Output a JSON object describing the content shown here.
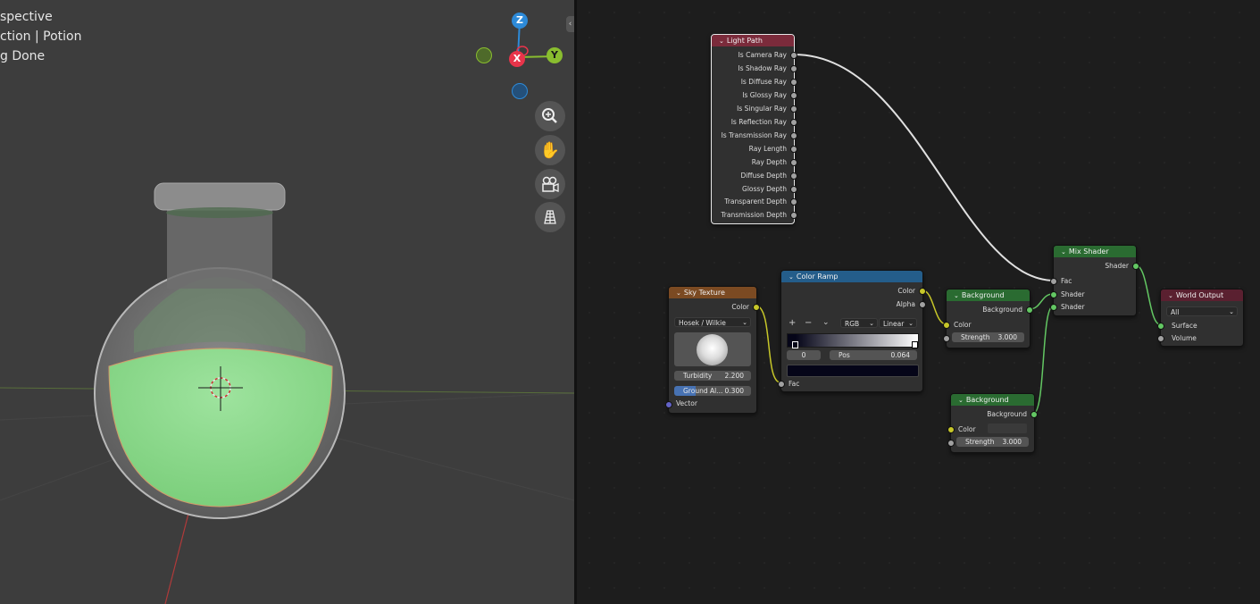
{
  "viewport": {
    "overlay_lines": [
      "spective",
      "ction | Potion",
      "g Done"
    ],
    "gizmo": {
      "z_label": "Z",
      "x_label": "X",
      "y_label": "Y",
      "x_color": "#e8344a",
      "y_color": "#89bd2f",
      "z_color": "#2d8ad8"
    },
    "nav_buttons": [
      {
        "name": "zoom-icon",
        "glyph": "⊕"
      },
      {
        "name": "hand-pan-icon",
        "glyph": "✋"
      },
      {
        "name": "camera-view-icon",
        "glyph": "🎥"
      },
      {
        "name": "grid-ortho-icon",
        "glyph": "▦"
      }
    ],
    "collapse_glyph": "‹"
  },
  "nodes": {
    "light_path": {
      "title": "Light Path",
      "header_color": "#7b2b3b",
      "outputs": [
        "Is Camera Ray",
        "Is Shadow Ray",
        "Is Diffuse Ray",
        "Is Glossy Ray",
        "Is Singular Ray",
        "Is Reflection Ray",
        "Is Transmission Ray",
        "Ray Length",
        "Ray Depth",
        "Diffuse Depth",
        "Glossy Depth",
        "Transparent Depth",
        "Transmission Depth"
      ]
    },
    "sky_texture": {
      "title": "Sky Texture",
      "header_color": "#7b4a22",
      "output": "Color",
      "type_value": "Hosek / Wilkie",
      "turbidity_label": "Turbidity",
      "turbidity_value": "2.200",
      "ground_label": "Ground Al...",
      "ground_value": "0.300",
      "input": "Vector"
    },
    "color_ramp": {
      "title": "Color Ramp",
      "header_color": "#245d8a",
      "out_color": "Color",
      "out_alpha": "Alpha",
      "add": "+",
      "remove": "−",
      "menu": "⌄",
      "mode": "RGB",
      "interp": "Linear",
      "index": "0",
      "pos_label": "Pos",
      "pos_value": "0.064",
      "input": "Fac"
    },
    "background1": {
      "title": "Background",
      "header_color": "#2a6b31",
      "output": "Background",
      "color_label": "Color",
      "strength_label": "Strength",
      "strength_value": "3.000"
    },
    "background2": {
      "title": "Background",
      "header_color": "#2a6b31",
      "output": "Background",
      "color_label": "Color",
      "strength_label": "Strength",
      "strength_value": "3.000"
    },
    "mix_shader": {
      "title": "Mix Shader",
      "header_color": "#2a6b31",
      "output": "Shader",
      "fac": "Fac",
      "shader1": "Shader",
      "shader2": "Shader"
    },
    "world_output": {
      "title": "World Output",
      "header_color": "#5a2030",
      "target": "All",
      "surface": "Surface",
      "volume": "Volume"
    }
  }
}
